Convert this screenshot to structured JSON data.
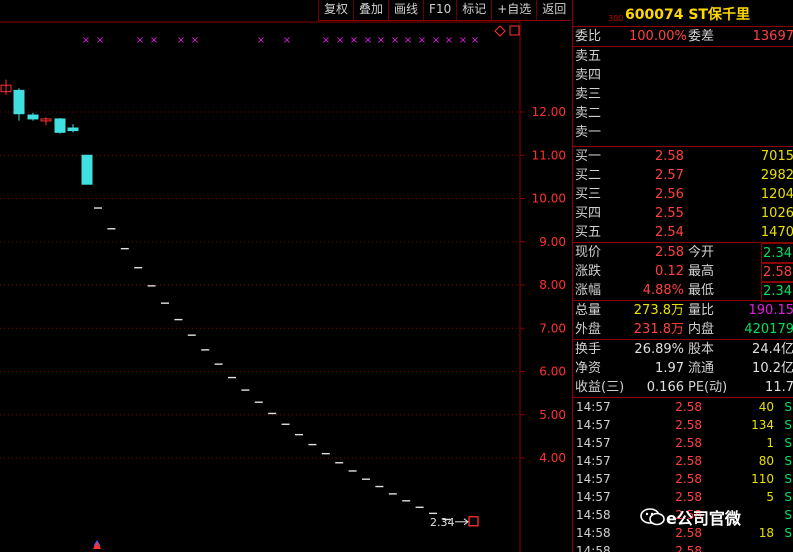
{
  "toolbar": [
    "复权",
    "叠加",
    "画线",
    "F10",
    "标记",
    "+自选",
    "返回"
  ],
  "chart": {
    "axis_labels": [
      "12.00",
      "11.00",
      "10.00",
      "9.00",
      "8.00",
      "7.00",
      "6.00",
      "5.00",
      "4.00"
    ],
    "last_price_label": "2.34",
    "colors": {
      "up": "#ff3030",
      "down": "#40e0e0",
      "mark": "#e020e0",
      "grid": "#8b0000"
    }
  },
  "header": {
    "sup": "300",
    "code": "600074 ST保千里"
  },
  "ratio": {
    "label1": "委比",
    "val1": "100.00%",
    "label2": "委差",
    "val2": "13697"
  },
  "sell": [
    {
      "label": "卖五"
    },
    {
      "label": "卖四"
    },
    {
      "label": "卖三"
    },
    {
      "label": "卖二"
    },
    {
      "label": "卖一"
    }
  ],
  "buy": [
    {
      "label": "买一",
      "price": "2.58",
      "vol": "7015"
    },
    {
      "label": "买二",
      "price": "2.57",
      "vol": "2982"
    },
    {
      "label": "买三",
      "price": "2.56",
      "vol": "1204"
    },
    {
      "label": "买四",
      "price": "2.55",
      "vol": "1026"
    },
    {
      "label": "买五",
      "price": "2.54",
      "vol": "1470"
    }
  ],
  "quote": [
    {
      "l1": "现价",
      "v1": "2.58",
      "l2": "今开",
      "v2": "2.34"
    },
    {
      "l1": "涨跌",
      "v1": "0.12",
      "l2": "最高",
      "v2": "2.58"
    },
    {
      "l1": "涨幅",
      "v1": "4.88%",
      "l2": "最低",
      "v2": "2.34"
    }
  ],
  "volume": [
    {
      "l1": "总量",
      "v1": "273.8万",
      "l2": "量比",
      "v2": "190.15"
    },
    {
      "l1": "外盘",
      "v1": "231.8万",
      "l2": "内盘",
      "v2": "420179"
    }
  ],
  "fund": [
    {
      "l1": "换手",
      "v1": "26.89%",
      "l2": "股本",
      "v2": "24.4亿"
    },
    {
      "l1": "净资",
      "v1": "1.97",
      "l2": "流通",
      "v2": "10.2亿"
    },
    {
      "l1": "收益(三)",
      "v1": "0.166",
      "l2": "PE(动)",
      "v2": "11.7"
    }
  ],
  "ticks": [
    {
      "t": "14:57",
      "p": "2.58",
      "v": "40",
      "s": "S"
    },
    {
      "t": "14:57",
      "p": "2.58",
      "v": "134",
      "s": "S"
    },
    {
      "t": "14:57",
      "p": "2.58",
      "v": "1",
      "s": "S"
    },
    {
      "t": "14:57",
      "p": "2.58",
      "v": "80",
      "s": "S"
    },
    {
      "t": "14:57",
      "p": "2.58",
      "v": "110",
      "s": "S"
    },
    {
      "t": "14:57",
      "p": "2.58",
      "v": "5",
      "s": "S"
    },
    {
      "t": "14:58",
      "p": "2.58",
      "v": "",
      "s": "S"
    },
    {
      "t": "14:58",
      "p": "2.58",
      "v": "18",
      "s": "S"
    },
    {
      "t": "14:58",
      "p": "2.58",
      "v": "",
      "s": ""
    }
  ],
  "watermark": "e公司官微"
}
